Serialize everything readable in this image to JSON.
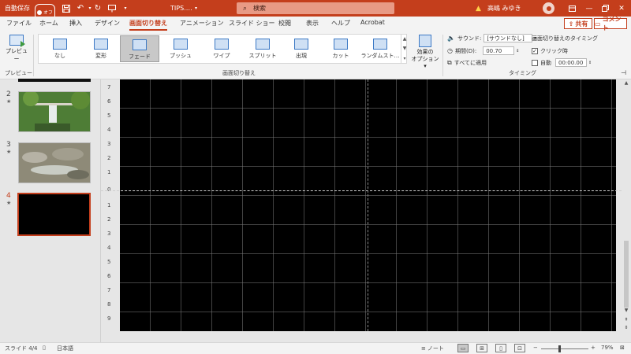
{
  "titlebar": {
    "autosave_label": "自動保存",
    "autosave_state": "オフ",
    "doc_title": "TIPS.…",
    "search_placeholder": "検索",
    "user_name": "高嶋 みゆき"
  },
  "tabs": [
    {
      "label": "ファイル"
    },
    {
      "label": "ホーム"
    },
    {
      "label": "挿入"
    },
    {
      "label": "デザイン"
    },
    {
      "label": "画面切り替え",
      "active": true
    },
    {
      "label": "アニメーション"
    },
    {
      "label": "スライド ショー"
    },
    {
      "label": "校閲"
    },
    {
      "label": "表示"
    },
    {
      "label": "ヘルプ"
    },
    {
      "label": "Acrobat"
    }
  ],
  "share": {
    "label": "共有"
  },
  "comment": {
    "label": "コメント"
  },
  "ribbon": {
    "preview_label": "プレビュー",
    "preview_group": "プレビュー",
    "transitions_group": "画面切り替え",
    "transitions": [
      {
        "label": "なし"
      },
      {
        "label": "変形"
      },
      {
        "label": "フェード",
        "selected": true
      },
      {
        "label": "プッシュ"
      },
      {
        "label": "ワイプ"
      },
      {
        "label": "スプリット"
      },
      {
        "label": "出現"
      },
      {
        "label": "カット"
      },
      {
        "label": "ランダムスト…"
      }
    ],
    "effect_options_line1": "効果の",
    "effect_options_line2": "オプション",
    "timing_group": "タイミング",
    "sound_label": "サウンド:",
    "sound_value": "[サウンドなし]",
    "duration_label": "期間(D):",
    "duration_value": "00.70",
    "apply_all_label": "すべてに適用",
    "timing_header": "画面切り替えのタイミング",
    "on_click_label": "クリック時",
    "on_click_checked": true,
    "auto_label": "自動",
    "auto_value": "00:00.00",
    "auto_checked": false
  },
  "slides": [
    {
      "number": "2",
      "star": "★"
    },
    {
      "number": "3",
      "star": "★"
    },
    {
      "number": "4",
      "star": "★",
      "active": true
    }
  ],
  "ruler_labels": [
    "7",
    "6",
    "5",
    "4",
    "3",
    "2",
    "1",
    "0",
    "1",
    "2",
    "3",
    "4",
    "5",
    "6",
    "7",
    "8",
    "9"
  ],
  "statusbar": {
    "slide_label": "スライド 4/4",
    "language": "日本語",
    "notes_label": "ノート",
    "zoom": "79%"
  },
  "colors": {
    "accent": "#c43e1c"
  }
}
